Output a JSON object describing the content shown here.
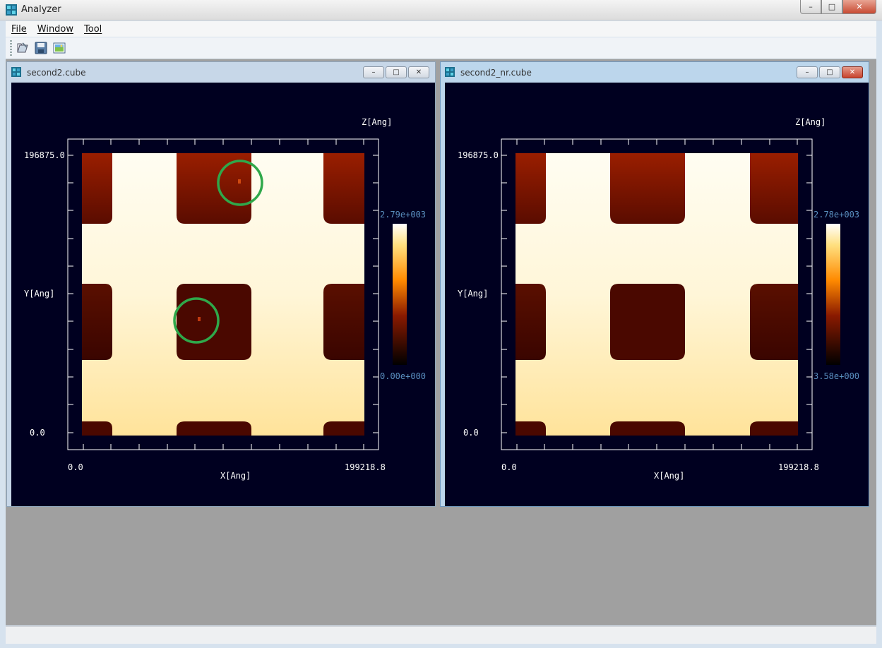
{
  "app": {
    "title": "Analyzer"
  },
  "window_buttons": {
    "minimize": "–",
    "maximize": "□",
    "close": "✕"
  },
  "menu": [
    "File",
    "Window",
    "Tool"
  ],
  "toolbar": {
    "icons": [
      "open-icon",
      "save-icon",
      "image-icon"
    ]
  },
  "panels": [
    {
      "title": "second2.cube",
      "z_label": "Z[Ang]",
      "y_label": "Y[Ang]",
      "x_label": "X[Ang]",
      "y_max": "196875.0",
      "y_min": "0.0",
      "x_min": "0.0",
      "x_max": "199218.8",
      "cb_max": "2.79e+003",
      "cb_min": "0.00e+000",
      "annotation_circles": 2
    },
    {
      "title": "second2_nr.cube",
      "z_label": "Z[Ang]",
      "y_label": "Y[Ang]",
      "x_label": "X[Ang]",
      "y_max": "196875.0",
      "y_min": "0.0",
      "x_min": "0.0",
      "x_max": "199218.8",
      "cb_max": "2.78e+003",
      "cb_min": "3.58e+000",
      "annotation_circles": 0
    }
  ],
  "colors": {
    "plot_bg": "#000020",
    "dark_region": "#5a0a00",
    "bright_region": "#fff8d8",
    "annotation": "#2fa84a",
    "colorbar_text": "#5a8fc0"
  }
}
